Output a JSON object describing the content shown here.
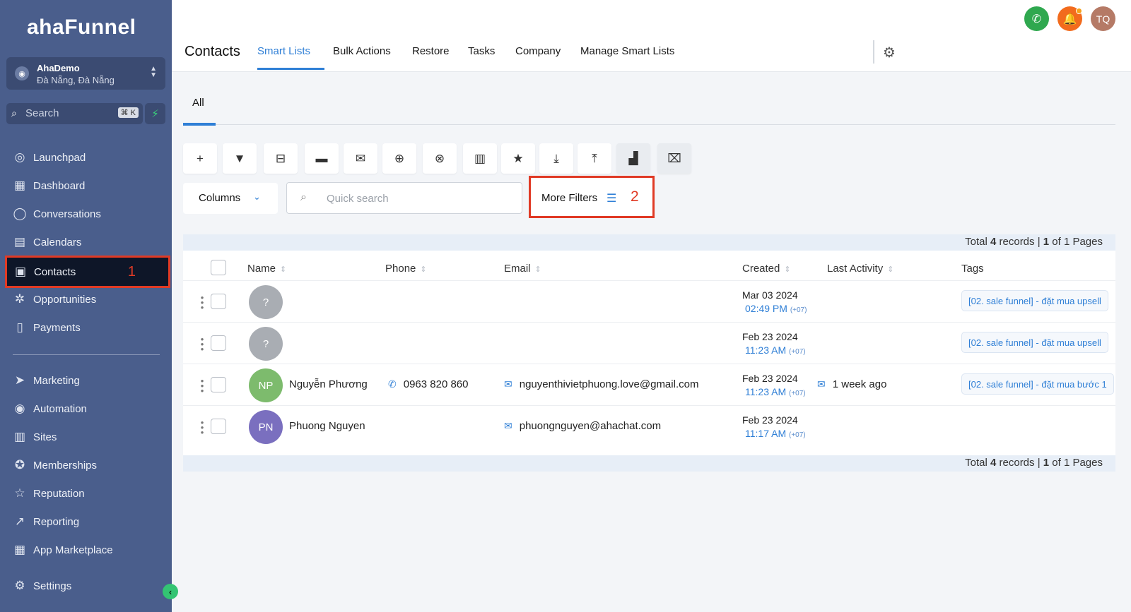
{
  "brand": {
    "logo": "ahaFunnel"
  },
  "account": {
    "name": "AhaDemo",
    "location": "Đà Nẵng, Đà Nẵng"
  },
  "sidebar_search": {
    "placeholder": "Search",
    "shortcut": "⌘ K"
  },
  "sidebar": {
    "items": [
      {
        "label": "Launchpad",
        "icon": "rocket-icon",
        "glyph": "◎"
      },
      {
        "label": "Dashboard",
        "icon": "grid-icon",
        "glyph": "▦"
      },
      {
        "label": "Conversations",
        "icon": "chat-bubble-icon",
        "glyph": "◯"
      },
      {
        "label": "Calendars",
        "icon": "calendar-icon",
        "glyph": "▤"
      },
      {
        "label": "Contacts",
        "icon": "contact-book-icon",
        "glyph": "▣",
        "active": true,
        "annotation": "1"
      },
      {
        "label": "Opportunities",
        "icon": "network-icon",
        "glyph": "✲"
      },
      {
        "label": "Payments",
        "icon": "receipt-icon",
        "glyph": "▯"
      },
      {
        "label": "Marketing",
        "icon": "send-icon",
        "glyph": "➤"
      },
      {
        "label": "Automation",
        "icon": "automation-icon",
        "glyph": "◉"
      },
      {
        "label": "Sites",
        "icon": "sites-icon",
        "glyph": "▥"
      },
      {
        "label": "Memberships",
        "icon": "badge-icon",
        "glyph": "✪"
      },
      {
        "label": "Reputation",
        "icon": "star-icon",
        "glyph": "☆"
      },
      {
        "label": "Reporting",
        "icon": "trend-icon",
        "glyph": "↗"
      },
      {
        "label": "App Marketplace",
        "icon": "apps-icon",
        "glyph": "▦"
      },
      {
        "label": "Settings",
        "icon": "gear-icon",
        "glyph": "⚙"
      }
    ]
  },
  "header": {
    "title": "Contacts",
    "tabs": [
      "Smart Lists",
      "Bulk Actions",
      "Restore",
      "Tasks",
      "Company",
      "Manage Smart Lists"
    ],
    "user_initials": "TQ"
  },
  "subtabs": {
    "active": "All"
  },
  "toolbar": {
    "tools": [
      {
        "name": "add-contact-icon",
        "glyph": "+"
      },
      {
        "name": "filter-icon",
        "glyph": "▼"
      },
      {
        "name": "robot-icon",
        "glyph": "⊟"
      },
      {
        "name": "sms-icon",
        "glyph": "▬"
      },
      {
        "name": "email-icon",
        "glyph": "✉"
      },
      {
        "name": "add-tag-icon",
        "glyph": "⊕"
      },
      {
        "name": "remove-tag-icon",
        "glyph": "⊗"
      },
      {
        "name": "delete-icon",
        "glyph": "▥"
      },
      {
        "name": "star-icon",
        "glyph": "★"
      },
      {
        "name": "import-icon",
        "glyph": "⤓"
      },
      {
        "name": "export-icon",
        "glyph": "⤒"
      },
      {
        "name": "company-icon",
        "glyph": "▟"
      },
      {
        "name": "merge-icon",
        "glyph": "⌧"
      }
    ]
  },
  "filters": {
    "columns_label": "Columns",
    "search_placeholder": "Quick search",
    "more_filters_label": "More Filters",
    "more_filters_annotation": "2"
  },
  "pagination": {
    "prefix": "Total ",
    "total": "4",
    "mid": " records | ",
    "page": "1",
    "suffix": " of 1 Pages"
  },
  "table": {
    "headers": [
      "Name",
      "Phone",
      "Email",
      "Created",
      "Last Activity",
      "Tags"
    ],
    "rows": [
      {
        "initials": "?",
        "avatar_color": "#a9adb3",
        "name": "",
        "phone": "",
        "email": "",
        "created_date": "Mar 03 2024",
        "created_time": "02:49 PM",
        "tz": "(+07)",
        "last_activity": "",
        "tag": "[02. sale funnel] - đặt mua upsell"
      },
      {
        "initials": "?",
        "avatar_color": "#a9adb3",
        "name": "",
        "phone": "",
        "email": "",
        "created_date": "Feb 23 2024",
        "created_time": "11:23 AM",
        "tz": "(+07)",
        "last_activity": "",
        "tag": "[02. sale funnel] - đặt mua upsell"
      },
      {
        "initials": "NP",
        "avatar_color": "#7dbb6d",
        "name": "Nguyễn Phương",
        "phone": "0963 820 860",
        "email": "nguyenthivietphuong.love@gmail.com",
        "created_date": "Feb 23 2024",
        "created_time": "11:23 AM",
        "tz": "(+07)",
        "last_activity": "1 week ago",
        "tag": "[02. sale funnel] - đặt mua bước 1"
      },
      {
        "initials": "PN",
        "avatar_color": "#7a6fbf",
        "name": "Phuong Nguyen",
        "phone": "",
        "email": "phuongnguyen@ahachat.com",
        "created_date": "Feb 23 2024",
        "created_time": "11:17 AM",
        "tz": "(+07)",
        "last_activity": "",
        "tag": ""
      }
    ]
  },
  "colors": {
    "accent": "#2f7fd6",
    "sidebar": "#4a5e8c",
    "annotation": "#e03a25"
  }
}
